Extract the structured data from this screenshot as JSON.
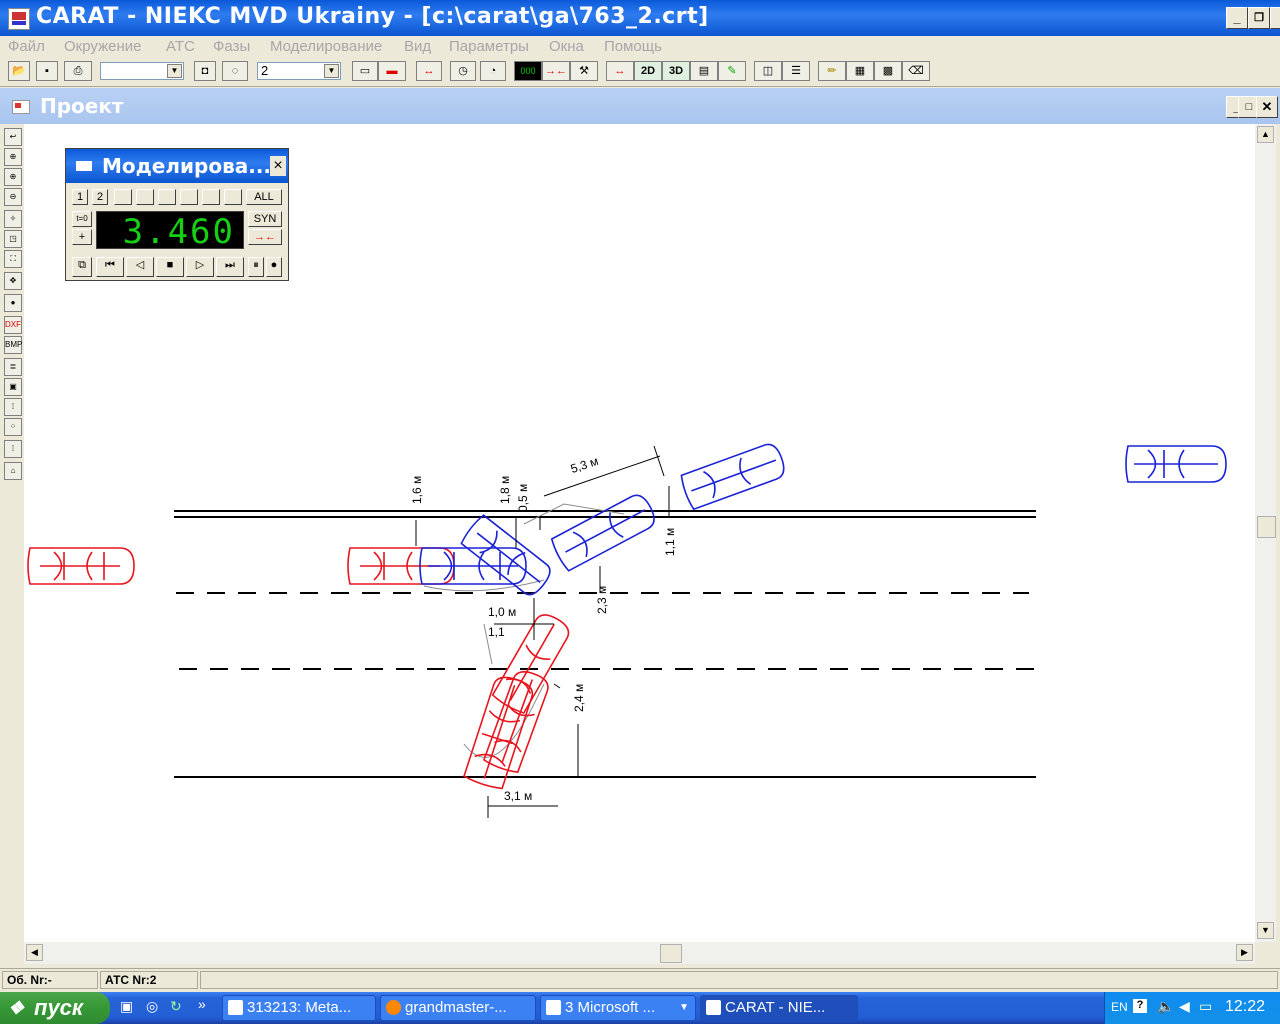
{
  "app": {
    "title": "CARAT - NIEKC MVD Ukrainy - [c:\\carat\\ga\\763_2.crt]"
  },
  "menu": [
    "Файл",
    "Окружение",
    "АТС",
    "Фазы",
    "Моделирование",
    "Вид",
    "Параметры",
    "Окна",
    "Помощь"
  ],
  "toolbar": {
    "combo1_value": "",
    "combo2_value": "2",
    "btn_2d": "2D",
    "btn_3d": "3D"
  },
  "child": {
    "title": "Проект"
  },
  "lefttools": {
    "dxf": "DXF",
    "bmp": "BMP"
  },
  "simulation": {
    "title": "Моделирова...",
    "close": "×",
    "phase1": "1",
    "phase2": "2",
    "all": "ALL",
    "t0": "t=0",
    "plus": "+",
    "time": "3.460",
    "syn": "SYN"
  },
  "drawing": {
    "dims": {
      "d53": "5,3 м",
      "d16": "1,6 м",
      "d18": "1,8 м",
      "d05": "0,5 м",
      "d11a": "1,1 м",
      "d23": "2,3 м",
      "d10": "1,0 м",
      "d11b": "1,1",
      "d24": "2,4 м",
      "d31": "3,1 м"
    },
    "colors": {
      "red": "#e8141e",
      "blue": "#1a22d6",
      "gray": "#8c8c8c"
    }
  },
  "status": {
    "ob": "Об. Nr:-",
    "ats": "АТС Nr:2"
  },
  "taskbar": {
    "start": "пуск",
    "items": [
      "313213: Meta...",
      "grandmaster-...",
      "3 Microsoft ...",
      "CARAT - NIE..."
    ],
    "lang": "EN",
    "clock": "12:22"
  }
}
